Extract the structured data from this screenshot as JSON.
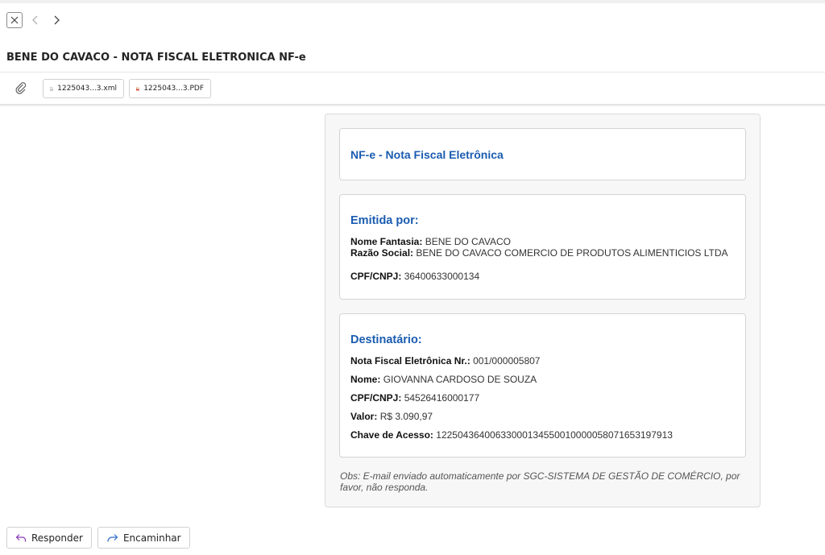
{
  "header": {
    "subject": "BENE DO CAVACO - NOTA FISCAL ELETRONICA NF-e"
  },
  "attachments": [
    {
      "name": "1225043...3.xml",
      "type": "xml"
    },
    {
      "name": "1225043...3.PDF",
      "type": "pdf"
    }
  ],
  "message": {
    "title": "NF-e - Nota Fiscal Eletrônica",
    "emitente": {
      "heading": "Emitida por:",
      "nome_fantasia_label": "Nome Fantasia:",
      "nome_fantasia": "BENE DO CAVACO",
      "razao_social_label": "Razão Social:",
      "razao_social": "BENE DO CAVACO COMERCIO DE PRODUTOS ALIMENTICIOS LTDA",
      "cpf_cnpj_label": "CPF/CNPJ:",
      "cpf_cnpj": "36400633000134"
    },
    "destinatario": {
      "heading": "Destinatário:",
      "nota_label": "Nota Fiscal Eletrônica Nr.:",
      "nota": "001/000005807",
      "nome_label": "Nome:",
      "nome": "GIOVANNA CARDOSO DE SOUZA",
      "cpf_cnpj_label": "CPF/CNPJ:",
      "cpf_cnpj": "54526416000177",
      "valor_label": "Valor:",
      "valor": "R$ 3.090,97",
      "chave_label": "Chave de Acesso:",
      "chave": "12250436400633000134550010000058071653197913"
    },
    "obs": "Obs: E-mail enviado automaticamente por SGC-SISTEMA DE GESTÃO DE COMÉRCIO, por favor, não responda."
  },
  "actions": {
    "reply_label": "Responder",
    "forward_label": "Encaminhar"
  },
  "icons": {
    "close": "close-icon",
    "back": "chevron-left-icon",
    "forward_nav": "chevron-right-icon",
    "attachment": "paperclip-icon",
    "xml_file": "file-icon",
    "pdf_file": "pdf-icon",
    "reply": "reply-icon",
    "forward": "forward-icon"
  },
  "colors": {
    "accent_blue": "#1a5cb0",
    "reply_purple": "#8a3ab9",
    "forward_blue": "#2f6fca"
  }
}
